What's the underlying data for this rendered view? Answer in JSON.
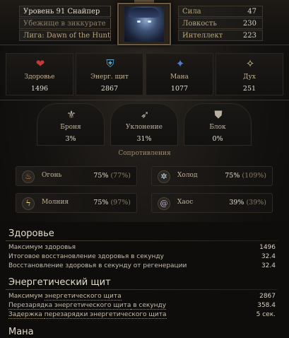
{
  "header": {
    "level_text": "Уровень 91 Снайпер",
    "hideout_text": "Убежище в зиккурате",
    "league_text": "Лига: Dawn of the Hunt",
    "attributes": [
      {
        "label": "Сила",
        "value": "47"
      },
      {
        "label": "Ловкость",
        "value": "230"
      },
      {
        "label": "Интеллект",
        "value": "223"
      }
    ]
  },
  "main_stats": [
    {
      "label": "Здоровье",
      "value": "1496",
      "icon": "heart-icon",
      "color": "#c23b3b"
    },
    {
      "label": "Энерг. щит",
      "value": "2867",
      "icon": "energy-shield-icon",
      "color": "#5fa7c7"
    },
    {
      "label": "Мана",
      "value": "1077",
      "icon": "mana-icon",
      "color": "#4b7fcf"
    },
    {
      "label": "Дух",
      "value": "251",
      "icon": "spirit-icon",
      "color": "#d8c39a"
    }
  ],
  "defences": [
    {
      "label": "Броня",
      "value": "3%",
      "icon": "armour-icon"
    },
    {
      "label": "Уклонение",
      "value": "31%",
      "icon": "evasion-icon"
    },
    {
      "label": "Блок",
      "value": "0%",
      "icon": "block-icon"
    }
  ],
  "resistances": {
    "title": "Сопротивления",
    "items": [
      {
        "label": "Огонь",
        "value": "75%",
        "max": "(77%)",
        "icon": "fire-icon"
      },
      {
        "label": "Холод",
        "value": "75%",
        "max": "(109%)",
        "icon": "cold-icon"
      },
      {
        "label": "Молния",
        "value": "75%",
        "max": "(97%)",
        "icon": "lightning-icon"
      },
      {
        "label": "Хаос",
        "value": "39%",
        "max": "(39%)",
        "icon": "chaos-icon"
      }
    ]
  },
  "sections": {
    "life": {
      "title": "Здоровье",
      "lines": [
        {
          "label": "Максимум здоровья",
          "value": "1496"
        },
        {
          "label": "Итоговое восстановление здоровья в секунду",
          "value": "32.4"
        },
        {
          "label": "Восстановление здоровья в секунду от регенерации",
          "value": "32.4"
        }
      ]
    },
    "es": {
      "title": "Энергетический щит",
      "lines": [
        {
          "prefix": "Максимум ",
          "term": "энергетического щита",
          "suffix": "",
          "value": "2867"
        },
        {
          "prefix": "",
          "term": "Перезарядка энергетического щита",
          "suffix": " в секунду",
          "value": "358.4"
        },
        {
          "prefix": "Задержка ",
          "term": "перезарядки энергетического щита",
          "suffix": "",
          "value": "5 сек."
        }
      ]
    },
    "mana": {
      "title": "Мана"
    }
  }
}
